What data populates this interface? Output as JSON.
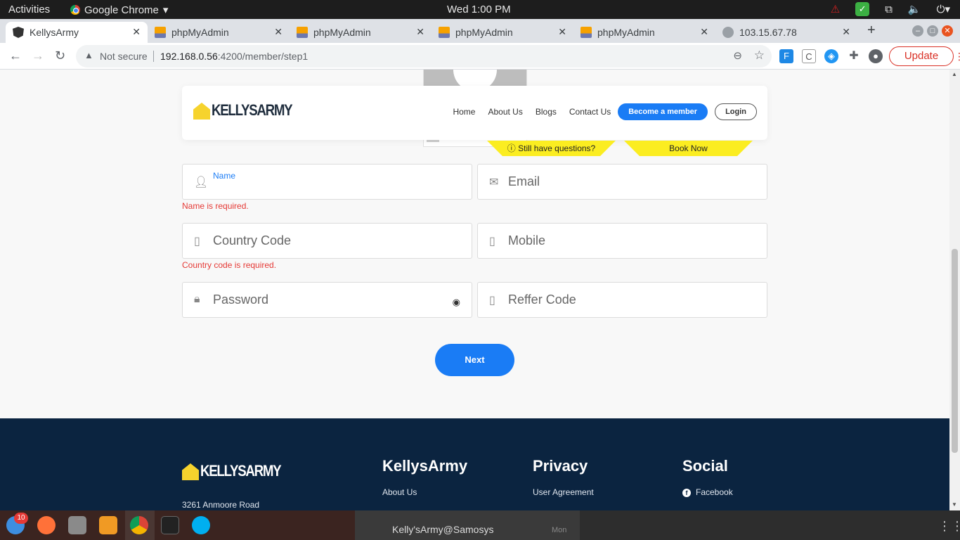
{
  "system_bar": {
    "activities": "Activities",
    "app_name": "Google Chrome",
    "clock": "Wed  1:00 PM"
  },
  "tabs": [
    {
      "label": "KellysArmy",
      "active": true,
      "icon": "angular-icon"
    },
    {
      "label": "phpMyAdmin",
      "active": false,
      "icon": "phpmyadmin-icon"
    },
    {
      "label": "phpMyAdmin",
      "active": false,
      "icon": "phpmyadmin-icon"
    },
    {
      "label": "phpMyAdmin",
      "active": false,
      "icon": "phpmyadmin-icon"
    },
    {
      "label": "phpMyAdmin",
      "active": false,
      "icon": "phpmyadmin-icon"
    },
    {
      "label": "103.15.67.78",
      "active": false,
      "icon": "globe-icon"
    }
  ],
  "omnibox": {
    "security": "Not secure",
    "url_host": "192.168.0.56",
    "url_path": ":4200/member/step1"
  },
  "update_button": "Update",
  "site": {
    "logo_text": "KELLYSARMY",
    "nav": {
      "home": "Home",
      "about": "About Us",
      "blogs": "Blogs",
      "contact": "Contact Us",
      "become_member": "Become a member",
      "login": "Login"
    },
    "ribbon_questions": "Still have questions?",
    "ribbon_book": "Book Now",
    "form": {
      "name_label": "Name",
      "email_placeholder": "Email",
      "name_error": "Name is required.",
      "country_code_placeholder": "Country Code",
      "mobile_placeholder": "Mobile",
      "country_code_error": "Country code is required.",
      "password_placeholder": "Password",
      "reffer_code_placeholder": "Reffer Code",
      "next_button": "Next"
    },
    "footer": {
      "logo_text": "KELLYSARMY",
      "address": "3261 Anmoore Road",
      "col1_title": "KellysArmy",
      "col1_link": "About Us",
      "col2_title": "Privacy",
      "col2_link": "User Agreement",
      "col3_title": "Social",
      "col3_link": "Facebook"
    }
  },
  "dock": {
    "badge_count": "10",
    "notification_text": "Kelly'sArmy@Samosys",
    "notification_time": "Mon"
  },
  "colors": {
    "primary_blue": "#1a7cf5",
    "ribbon_yellow": "#fbed21",
    "error_red": "#e53935",
    "footer_navy": "#0b2440"
  }
}
